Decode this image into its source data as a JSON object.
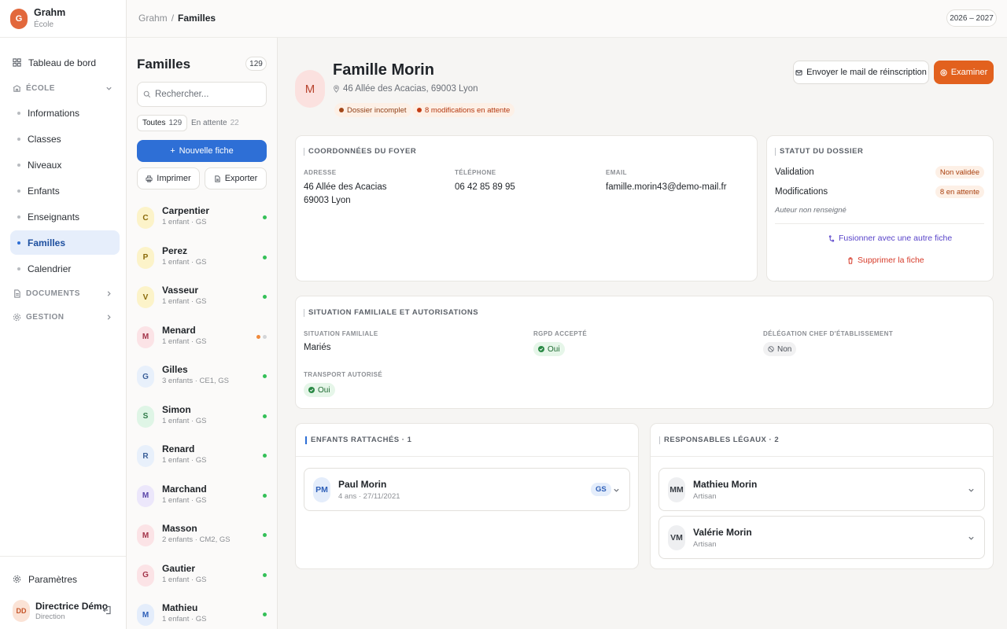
{
  "app": {
    "name": "Grahm",
    "subtitle": "École",
    "initial": "G"
  },
  "topbar": {
    "breadcrumb_root": "Grahm",
    "breadcrumb_sep": "/",
    "breadcrumb_current": "Familles",
    "year": "2026 – 2027"
  },
  "sidebar": {
    "dashboard": "Tableau de bord",
    "section_ecole": "ÉCOLE",
    "items": [
      "Informations",
      "Classes",
      "Niveaux",
      "Enfants",
      "Enseignants",
      "Familles",
      "Calendrier"
    ],
    "section_documents": "DOCUMENTS",
    "section_gestion": "GESTION",
    "settings": "Paramètres",
    "user": {
      "initials": "DD",
      "name": "Directrice Démo",
      "role": "Direction"
    }
  },
  "list": {
    "title": "Familles",
    "count": "129",
    "search_placeholder": "Rechercher...",
    "filters": [
      {
        "label": "Toutes",
        "count": "129"
      },
      {
        "label": "En attente",
        "count": "22"
      }
    ],
    "new_label": "Nouvelle fiche",
    "print_label": "Imprimer",
    "export_label": "Exporter",
    "families": [
      {
        "initial": "C",
        "name": "Carpentier",
        "sub": "1 enfant · GS",
        "bg": "#fcf3c9",
        "fg": "#8a6a0a"
      },
      {
        "initial": "P",
        "name": "Perez",
        "sub": "1 enfant · GS",
        "bg": "#fcf3c9",
        "fg": "#8a6a0a"
      },
      {
        "initial": "V",
        "name": "Vasseur",
        "sub": "1 enfant · GS",
        "bg": "#fcf3c9",
        "fg": "#8a6a0a"
      },
      {
        "initial": "M",
        "name": "Menard",
        "sub": "1 enfant · GS",
        "bg": "#fbe3e6",
        "fg": "#a3344a"
      },
      {
        "initial": "G",
        "name": "Gilles",
        "sub": "3 enfants · CE1, GS",
        "bg": "#e8f0fb",
        "fg": "#3b5f99"
      },
      {
        "initial": "S",
        "name": "Simon",
        "sub": "1 enfant · GS",
        "bg": "#dff5e6",
        "fg": "#2f7a48"
      },
      {
        "initial": "R",
        "name": "Renard",
        "sub": "1 enfant · GS",
        "bg": "#e8f0fb",
        "fg": "#3b5f99"
      },
      {
        "initial": "M",
        "name": "Marchand",
        "sub": "1 enfant · GS",
        "bg": "#ece7fb",
        "fg": "#5a45a8"
      },
      {
        "initial": "M",
        "name": "Masson",
        "sub": "2 enfants · CM2, GS",
        "bg": "#fbe3e6",
        "fg": "#a3344a"
      },
      {
        "initial": "G",
        "name": "Gautier",
        "sub": "1 enfant · GS",
        "bg": "#fbe3e6",
        "fg": "#a3344a"
      },
      {
        "initial": "M",
        "name": "Mathieu",
        "sub": "1 enfant · GS",
        "bg": "#e4edfb",
        "fg": "#2e5fb8"
      }
    ]
  },
  "header": {
    "initial": "M",
    "title": "Famille Morin",
    "address": "46 Allée des Acacias, 69003 Lyon",
    "badge1": "Dossier incomplet",
    "badge2": "8 modifications en attente",
    "mail_button": "Envoyer le mail de réinscription",
    "examine_button": "Examiner"
  },
  "coord": {
    "title": "COORDONNÉES DU FOYER",
    "addr_label": "ADRESSE",
    "addr_line1": "46 Allée des Acacias",
    "addr_line2": "69003 Lyon",
    "tel_label": "TÉLÉPHONE",
    "tel": "06 42 85 89 95",
    "email_label": "EMAIL",
    "email": "famille.morin43@demo-mail.fr"
  },
  "statut": {
    "title": "STATUT DU DOSSIER",
    "validation_label": "Validation",
    "validation_value": "Non validée",
    "modif_label": "Modifications",
    "modif_value": "8 en attente",
    "note": "Auteur non renseigné",
    "merge": "Fusionner avec une autre fiche",
    "delete": "Supprimer la fiche"
  },
  "situation": {
    "title": "SITUATION FAMILIALE ET AUTORISATIONS",
    "fam_label": "SITUATION FAMILIALE",
    "fam_value": "Mariés",
    "rgpd_label": "RGPD ACCEPTÉ",
    "rgpd_value": "Oui",
    "deleg_label": "DÉLÉGATION CHEF D'ÉTABLISSEMENT",
    "deleg_value": "Non",
    "transport_label": "TRANSPORT AUTORISÉ",
    "transport_value": "Oui"
  },
  "children": {
    "title": "ENFANTS RATTACHÉS · 1",
    "items": [
      {
        "initials": "PM",
        "name": "Paul Morin",
        "sub": "4 ans · 27/11/2021",
        "level": "GS"
      }
    ]
  },
  "guardians": {
    "title": "RESPONSABLES LÉGAUX · 2",
    "items": [
      {
        "initials": "MM",
        "name": "Mathieu Morin",
        "sub": "Artisan"
      },
      {
        "initials": "VM",
        "name": "Valérie Morin",
        "sub": "Artisan"
      }
    ]
  },
  "colors": {
    "accent": "#2e6fd6",
    "examine": "#e2611e",
    "brand": "#e2683c",
    "ok": "#34c058",
    "pending": "#f08a3c"
  }
}
